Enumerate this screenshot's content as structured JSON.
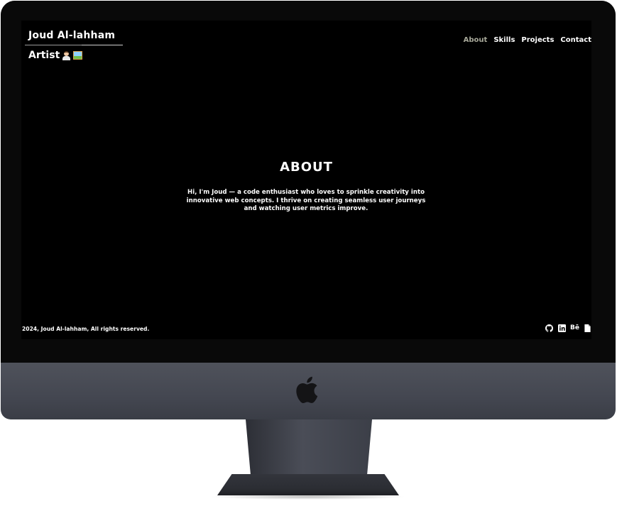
{
  "header": {
    "name": "Joud Al-lahham",
    "role": "Artist"
  },
  "nav": {
    "items": [
      {
        "label": "About",
        "active": true
      },
      {
        "label": "Skills",
        "active": false
      },
      {
        "label": "Projects",
        "active": false
      },
      {
        "label": "Contact",
        "active": false
      }
    ]
  },
  "about": {
    "title": "ABOUT",
    "text": "Hi, I'm Joud — a code enthusiast who loves to sprinkle creativity into innovative web concepts. I thrive on creating seamless user journeys and watching user metrics improve."
  },
  "footer": {
    "copyright": "2024, Joud Al-lahham, All rights reserved.",
    "icons": [
      "github-icon",
      "linkedin-icon",
      "behance-icon",
      "document-icon"
    ],
    "behance_glyph": "Bē"
  },
  "colors": {
    "screen_background": "#000000",
    "text": "#ffffff",
    "nav_active": "#a8a99a",
    "chin": "#4a4d56",
    "bezel": "#090909"
  }
}
